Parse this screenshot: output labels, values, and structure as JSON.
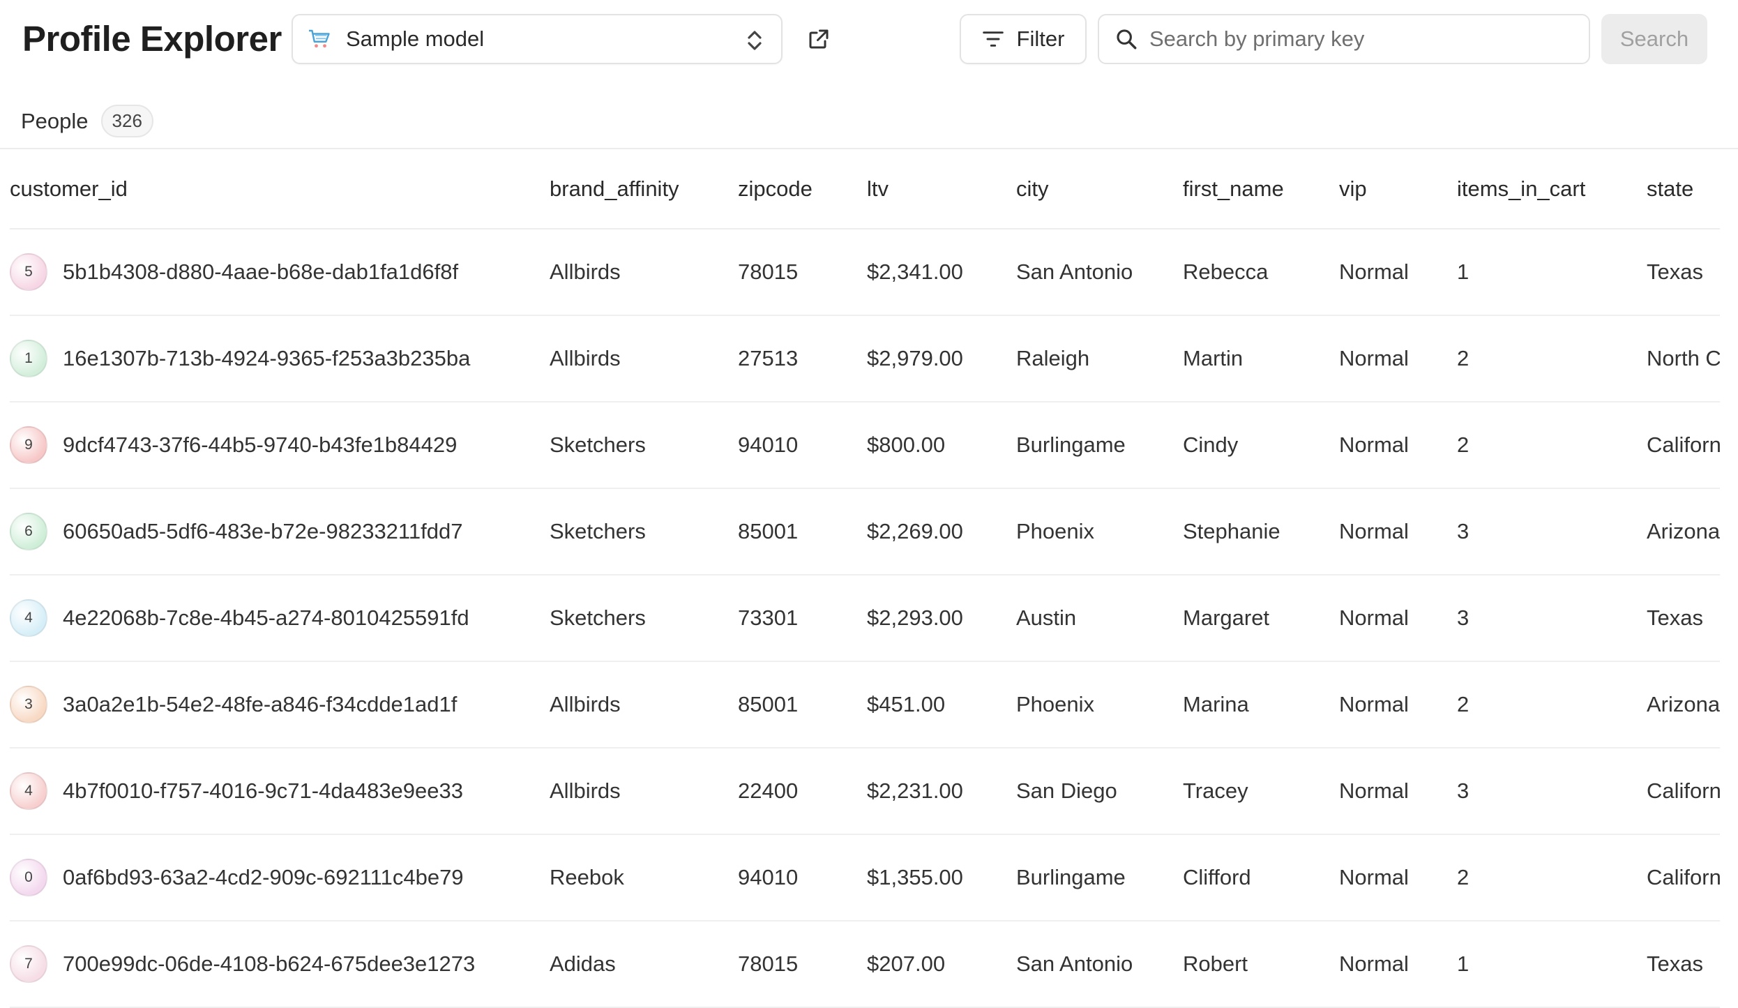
{
  "app": {
    "title": "Profile Explorer"
  },
  "model_select": {
    "value": "Sample model"
  },
  "toolbar": {
    "filter_label": "Filter",
    "search_placeholder": "Search by primary key",
    "search_button": "Search"
  },
  "tabs": [
    {
      "label": "People",
      "count": "326"
    }
  ],
  "table": {
    "columns": [
      "customer_id",
      "brand_affinity",
      "zipcode",
      "ltv",
      "city",
      "first_name",
      "vip",
      "items_in_cart",
      "state"
    ],
    "rows": [
      {
        "avatar": "5",
        "avatar_color": "#f6d6e4",
        "cells": [
          "5b1b4308-d880-4aae-b68e-dab1fa1d6f8f",
          "Allbirds",
          "78015",
          "$2,341.00",
          "San Antonio",
          "Rebecca",
          "Normal",
          "1",
          "Texas"
        ]
      },
      {
        "avatar": "1",
        "avatar_color": "#d3eedb",
        "cells": [
          "16e1307b-713b-4924-9365-f253a3b235ba",
          "Allbirds",
          "27513",
          "$2,979.00",
          "Raleigh",
          "Martin",
          "Normal",
          "2",
          "North C"
        ]
      },
      {
        "avatar": "9",
        "avatar_color": "#f7c8c8",
        "cells": [
          "9dcf4743-37f6-44b5-9740-b43fe1b84429",
          "Sketchers",
          "94010",
          "$800.00",
          "Burlingame",
          "Cindy",
          "Normal",
          "2",
          "Californ"
        ]
      },
      {
        "avatar": "6",
        "avatar_color": "#cfeed8",
        "cells": [
          "60650ad5-5df6-483e-b72e-98233211fdd7",
          "Sketchers",
          "85001",
          "$2,269.00",
          "Phoenix",
          "Stephanie",
          "Normal",
          "3",
          "Arizona"
        ]
      },
      {
        "avatar": "4",
        "avatar_color": "#d6eef8",
        "cells": [
          "4e22068b-7c8e-4b45-a274-8010425591fd",
          "Sketchers",
          "73301",
          "$2,293.00",
          "Austin",
          "Margaret",
          "Normal",
          "3",
          "Texas"
        ]
      },
      {
        "avatar": "3",
        "avatar_color": "#f8d9c4",
        "cells": [
          "3a0a2e1b-54e2-48fe-a846-f34cdde1ad1f",
          "Allbirds",
          "85001",
          "$451.00",
          "Phoenix",
          "Marina",
          "Normal",
          "2",
          "Arizona"
        ]
      },
      {
        "avatar": "4",
        "avatar_color": "#f7cfcf",
        "cells": [
          "4b7f0010-f757-4016-9c71-4da483e9ee33",
          "Allbirds",
          "22400",
          "$2,231.00",
          "San Diego",
          "Tracey",
          "Normal",
          "3",
          "Californ"
        ]
      },
      {
        "avatar": "0",
        "avatar_color": "#f3d8ee",
        "cells": [
          "0af6bd93-63a2-4cd2-909c-692111c4be79",
          "Reebok",
          "94010",
          "$1,355.00",
          "Burlingame",
          "Clifford",
          "Normal",
          "2",
          "Californ"
        ]
      },
      {
        "avatar": "7",
        "avatar_color": "#f6dde6",
        "cells": [
          "700e99dc-06de-4108-b624-675dee3e1273",
          "Adidas",
          "78015",
          "$207.00",
          "San Antonio",
          "Robert",
          "Normal",
          "1",
          "Texas"
        ]
      }
    ]
  },
  "colors": {
    "border": "#e3e3e3",
    "search_button_bg": "#ececec",
    "search_button_text": "#a0a0a0"
  },
  "icons": {
    "model": "shopping-cart-icon",
    "select": "chevron-up-down-icon",
    "open": "external-link-icon",
    "filter": "filter-icon",
    "search": "search-icon"
  }
}
